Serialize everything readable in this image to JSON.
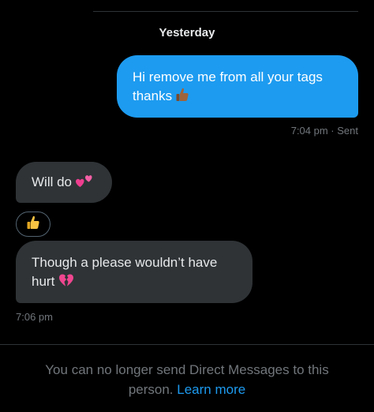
{
  "conversation": {
    "date_separator": "Yesterday",
    "messages": [
      {
        "direction": "outgoing",
        "line1": "Hi remove me from all your tags",
        "line2": "thanks",
        "emoji": "thumbs-up-icon",
        "meta": "7:04 pm · Sent"
      },
      {
        "direction": "incoming",
        "text": "Will do",
        "emoji": "two-hearts-icon",
        "reaction": "thumbs-up-icon"
      },
      {
        "direction": "incoming",
        "line1": "Though a please wouldn’t have",
        "line2": "hurt",
        "emoji": "broken-heart-icon",
        "meta": "7:06 pm"
      }
    ]
  },
  "footer": {
    "notice_text": "You can no longer send Direct Messages to this person.",
    "learn_more": "Learn more"
  },
  "colors": {
    "background": "#000000",
    "outgoing_bubble": "#1d9bf0",
    "incoming_bubble": "#2f3336",
    "meta_text": "#71767b",
    "link": "#1d9bf0"
  }
}
